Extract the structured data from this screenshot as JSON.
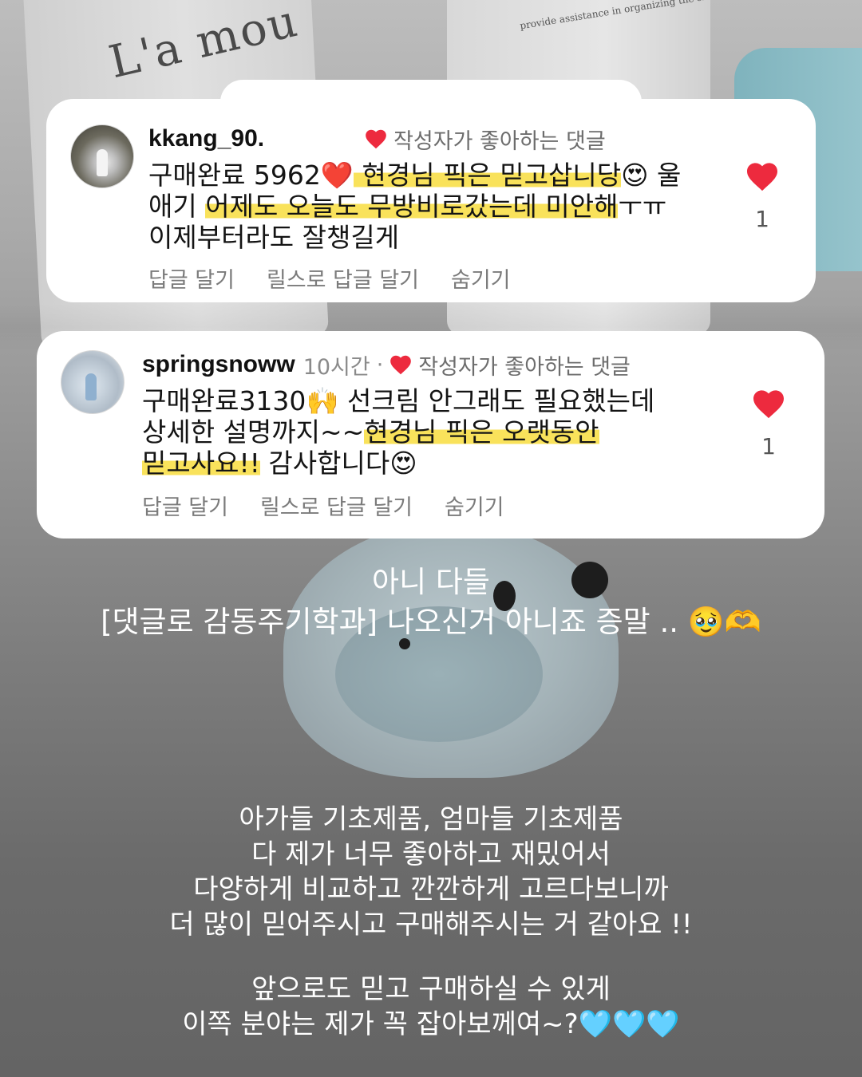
{
  "background": {
    "brand_text": "L'a mou",
    "brand_subtext": "provide assistance in organizing the skin"
  },
  "comments": [
    {
      "username": "kkang_90.",
      "timestamp": "",
      "author_liked_label": "작성자가 좋아하는 댓글",
      "text_parts": {
        "a": "구매완료 5962",
        "a_emoji": "❤️",
        "b_hl": " 현경님 픽은 믿고삽니당",
        "b_emoji": "😍",
        "c": " 울 애기 ",
        "c_hl": "어제도 오늘도 무방비로갔는데 미안해",
        "d": "ㅜㅠ 이제부터라도 잘챙길게"
      },
      "actions": [
        "답글 달기",
        "릴스로 답글 달기",
        "숨기기"
      ],
      "like_count": "1"
    },
    {
      "username": "springsnoww",
      "timestamp": "10시간",
      "separator": "·",
      "author_liked_label": "작성자가 좋아하는 댓글",
      "text_parts": {
        "a": "구매완료3130",
        "a_emoji": "🙌",
        "b": " 선크림 안그래도 필요했는데 상세한 설명까지~~",
        "b_hl": "현경님 픽은 오랫동안 믿고사요!!",
        "c": " 감사합니다",
        "c_emoji": "😍"
      },
      "actions": [
        "답글 달기",
        "릴스로 답글 달기",
        "숨기기"
      ],
      "like_count": "1"
    }
  ],
  "overlay": {
    "block1": {
      "line1": "아니 다들",
      "line2": "[댓글로 감동주기학과] 나오신거 아니죠 증말 .. ",
      "line2_emoji": "🥹🫶"
    },
    "block2": {
      "line1": "아가들 기초제품, 엄마들 기초제품",
      "line2": "다 제가 너무 좋아하고 재밌어서",
      "line3": "다양하게 비교하고 깐깐하게 고르다보니까",
      "line4": "더 많이 믿어주시고 구매해주시는 거 같아요 !!"
    },
    "block3": {
      "line1": "앞으로도 믿고 구매하실 수 있게",
      "line2": "이쪽 분야는 제가 꼭 잡아보께여~?",
      "line2_emoji": "🩵🩵🩵"
    }
  },
  "colors": {
    "heart_red": "#ed2a3e",
    "highlight_yellow": "#f9e25b",
    "card_bg": "#ffffff"
  },
  "icons": [
    "heart-icon",
    "avatar"
  ]
}
